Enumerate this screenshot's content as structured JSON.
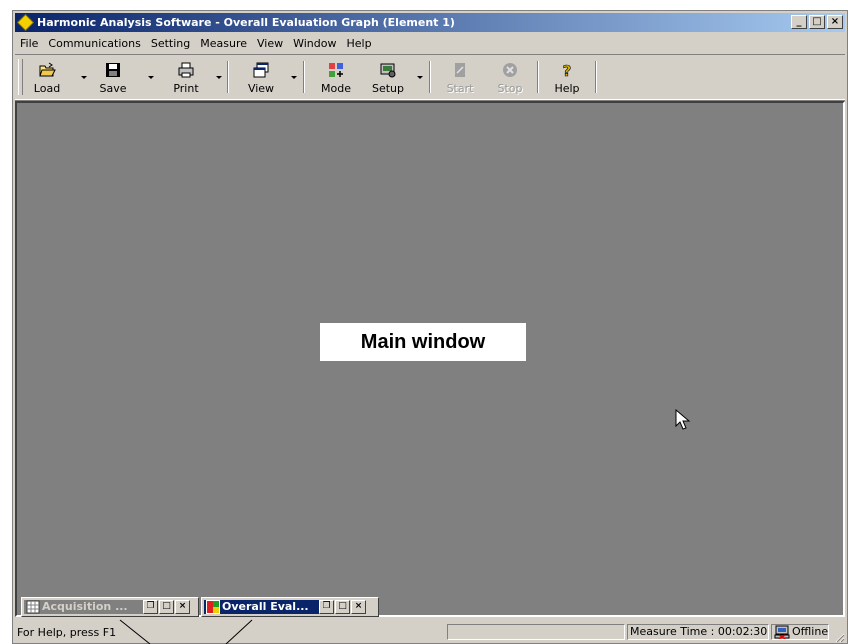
{
  "window": {
    "title": "Harmonic Analysis Software - Overall Evaluation Graph (Element 1)",
    "caption_buttons": {
      "minimize": "_",
      "maximize": "□",
      "close": "×"
    }
  },
  "menu": [
    "File",
    "Communications",
    "Setting",
    "Measure",
    "View",
    "Window",
    "Help"
  ],
  "toolbar": {
    "load": "Load",
    "save": "Save",
    "print": "Print",
    "view": "View",
    "mode": "Mode",
    "setup": "Setup",
    "start": "Start",
    "stop": "Stop",
    "help": "Help"
  },
  "main": {
    "callout": "Main window"
  },
  "minimized_windows": [
    {
      "title": "Acquisition ...",
      "state": "inactive"
    },
    {
      "title": "Overall Eval...",
      "state": "active"
    }
  ],
  "status": {
    "help": "For Help, press F1",
    "measure_time": "Measure Time : 00:02:30",
    "connection": "Offline"
  },
  "colors": {
    "titlebar": "#0a246a",
    "titlebar_end": "#a6caf0",
    "face": "#d4d0c8",
    "mdi_background": "#808080"
  }
}
